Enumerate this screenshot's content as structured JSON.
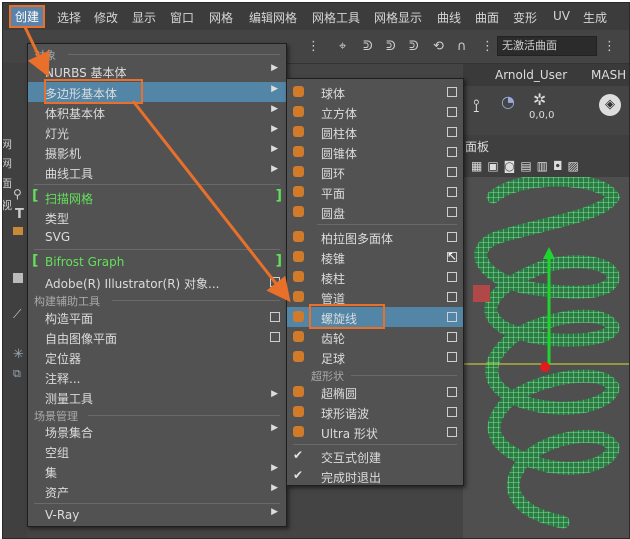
{
  "menubar": [
    "创建",
    "选择",
    "修改",
    "显示",
    "窗口",
    "网格",
    "编辑网格",
    "网格工具",
    "网格显示",
    "曲线",
    "曲面",
    "变形",
    "UV",
    "生成"
  ],
  "toolbar": {
    "curve_field": "无激活曲面"
  },
  "tabs": [
    "Arnold_User",
    "MASH"
  ],
  "shelf": {
    "coords": "0,0,0"
  },
  "viewport": {
    "panel_label": "面板"
  },
  "left_strip": [
    "网",
    "网",
    "面",
    "视"
  ],
  "create_menu": {
    "title": "对象",
    "items": [
      {
        "label": "NURBS 基本体",
        "arrow": "▶"
      },
      {
        "label": "多边形基本体",
        "arrow": "▶"
      },
      {
        "label": "体积基本体",
        "arrow": "▶"
      },
      {
        "label": "灯光",
        "arrow": "▶"
      },
      {
        "label": "摄影机",
        "arrow": "▶"
      },
      {
        "label": "曲线工具",
        "arrow": "▶"
      },
      {
        "label": "扫描网格"
      },
      {
        "label": "类型"
      },
      {
        "label": "SVG"
      },
      {
        "label": "Bifrost Graph"
      },
      {
        "label": "Adobe(R) Illustrator(R) 对象..."
      }
    ],
    "section_construct": "构建辅助工具",
    "construct_items": [
      {
        "label": "构造平面"
      },
      {
        "label": "自由图像平面"
      },
      {
        "label": "定位器"
      },
      {
        "label": "注释..."
      },
      {
        "label": "测量工具",
        "arrow": "▶"
      }
    ],
    "section_scene": "场景管理",
    "scene_items": [
      {
        "label": "场景集合",
        "arrow": "▶"
      },
      {
        "label": "空组"
      },
      {
        "label": "集",
        "arrow": "▶"
      },
      {
        "label": "资产",
        "arrow": "▶"
      }
    ],
    "vray": {
      "label": "V-Ray",
      "arrow": "▶"
    }
  },
  "poly_menu": {
    "items": [
      {
        "label": "球体"
      },
      {
        "label": "立方体"
      },
      {
        "label": "圆柱体"
      },
      {
        "label": "圆锥体"
      },
      {
        "label": "圆环"
      },
      {
        "label": "平面"
      },
      {
        "label": "圆盘"
      },
      {
        "label": "柏拉图多面体"
      },
      {
        "label": "棱锥"
      },
      {
        "label": "棱柱"
      },
      {
        "label": "管道"
      },
      {
        "label": "螺旋线"
      },
      {
        "label": "齿轮"
      },
      {
        "label": "足球"
      }
    ],
    "section_super": "超形状",
    "super_items": [
      {
        "label": "超椭圆"
      },
      {
        "label": "球形谐波"
      },
      {
        "label": "Ultra 形状"
      }
    ],
    "toggles": [
      {
        "label": "交互式创建",
        "checked": "✔"
      },
      {
        "label": "完成时退出",
        "checked": "✔"
      }
    ]
  },
  "colors": {
    "highlight": "#5285a6",
    "annotation": "#e8702a",
    "helix": "#7dff9a",
    "menu_bg": "#525252"
  }
}
